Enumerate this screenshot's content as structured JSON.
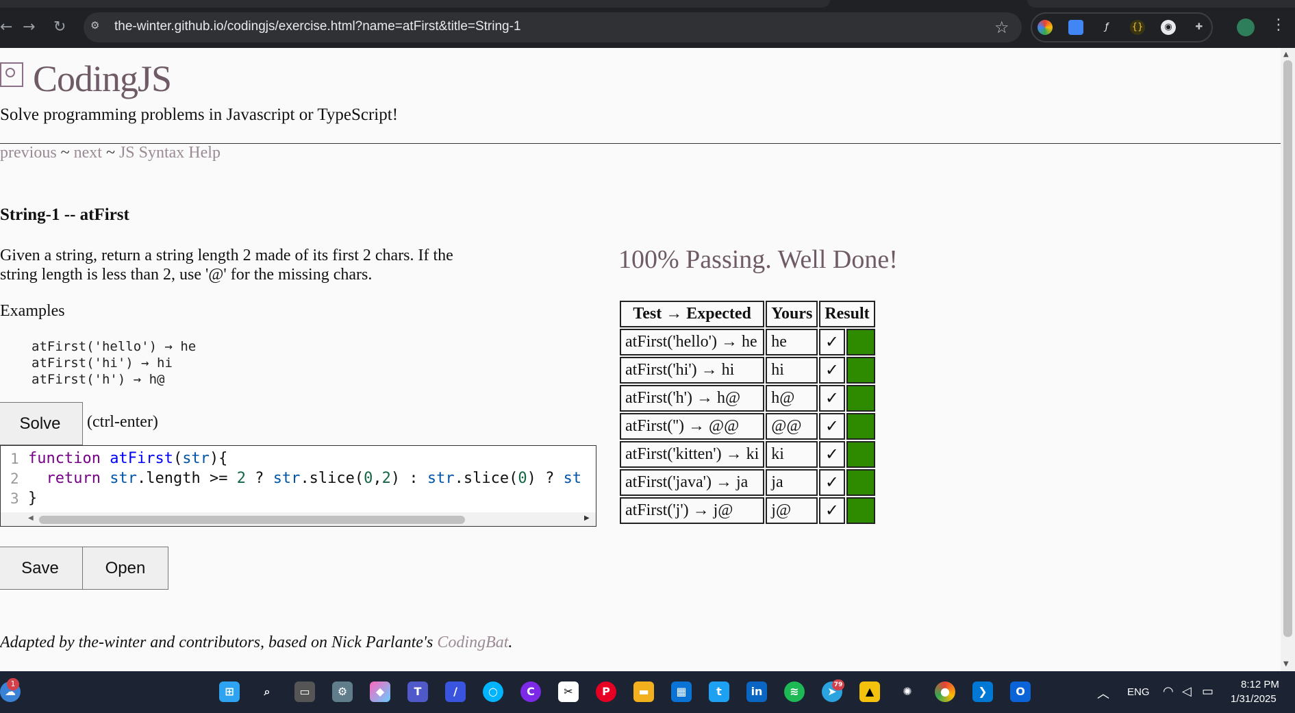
{
  "browser": {
    "url": "the-winter.github.io/codingjs/exercise.html?name=atFirst&title=String-1",
    "back_icon": "←",
    "forward_icon": "→",
    "reload_icon": "↻",
    "site_settings_icon": "⚙",
    "star_icon": "☆",
    "menu_icon": "⋮",
    "extensions": [
      "ext-a",
      "ext-b",
      "ext-c",
      "ext-d",
      "ext-e",
      "puzzle"
    ]
  },
  "header": {
    "logo_text": "CodingJS",
    "subtitle": "Solve programming problems in Javascript or TypeScript!",
    "nav": {
      "previous": "previous",
      "sep1": " ~ ",
      "next": "next",
      "sep2": " ~ ",
      "help": "JS Syntax Help"
    }
  },
  "problem": {
    "title": "String-1 -- atFirst",
    "description": "Given a string, return a string length 2 made of its first 2 chars. If the string length is less than 2, use '@' for the missing chars.",
    "examples_label": "Examples",
    "examples": [
      "atFirst('hello') → he",
      "atFirst('hi') → hi",
      "atFirst('h') → h@"
    ]
  },
  "controls": {
    "solve_label": "Solve",
    "solve_hint": "(ctrl-enter)",
    "save_label": "Save",
    "open_label": "Open"
  },
  "editor": {
    "line_numbers": [
      "1",
      "2",
      "3"
    ]
  },
  "results": {
    "status": "100% Passing. Well Done!",
    "headers": [
      "Test → Expected",
      "Yours",
      "Result"
    ],
    "rows": [
      {
        "test": "atFirst('hello') → he",
        "yours": "he",
        "check": "✓"
      },
      {
        "test": "atFirst('hi') → hi",
        "yours": "hi",
        "check": "✓"
      },
      {
        "test": "atFirst('h') → h@",
        "yours": "h@",
        "check": "✓"
      },
      {
        "test": "atFirst('') → @@",
        "yours": "@@",
        "check": "✓"
      },
      {
        "test": "atFirst('kitten') → ki",
        "yours": "ki",
        "check": "✓"
      },
      {
        "test": "atFirst('java') → ja",
        "yours": "ja",
        "check": "✓"
      },
      {
        "test": "atFirst('j') → j@",
        "yours": "j@",
        "check": "✓"
      }
    ],
    "pass_color": "#2e8b00"
  },
  "footer": {
    "text": "Adapted by the-winter and contributors, based on Nick Parlante's ",
    "link": "CodingBat",
    "end": "."
  },
  "taskbar": {
    "weather_badge": "1",
    "telegram_badge": "79",
    "lang": "ENG",
    "time": "8:12 PM",
    "date": "1/31/2025"
  }
}
